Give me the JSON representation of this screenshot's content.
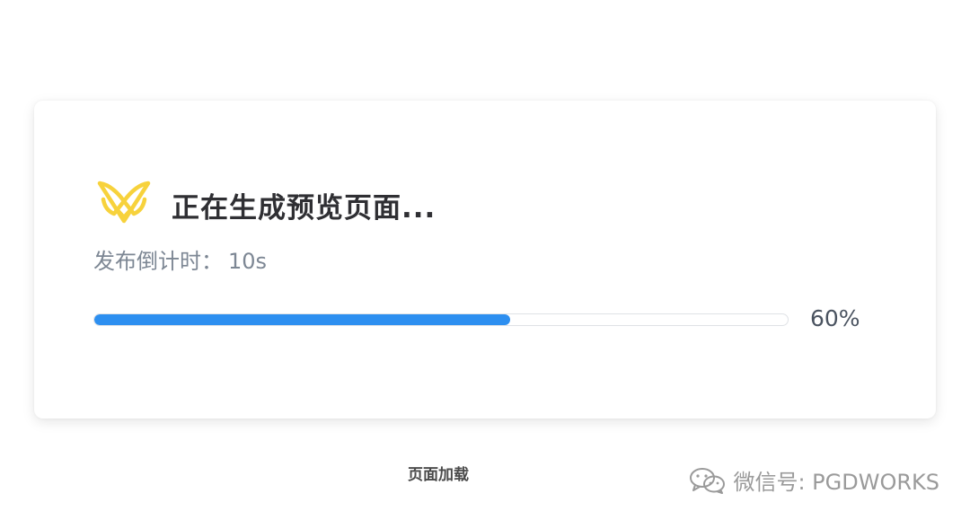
{
  "card": {
    "title": "正在生成预览页面...",
    "countdown_label": "发布倒计时：",
    "countdown_value": "10s",
    "progress_label": "60%",
    "progress_fraction": 0.6,
    "colors": {
      "accent": "#2d8ff0",
      "logo": "#f7d23c"
    },
    "logo_icon": "butterfly-logo-icon"
  },
  "caption": "页面加载",
  "watermark": {
    "icon": "wechat-icon",
    "text": "微信号: PGDWORKS"
  }
}
